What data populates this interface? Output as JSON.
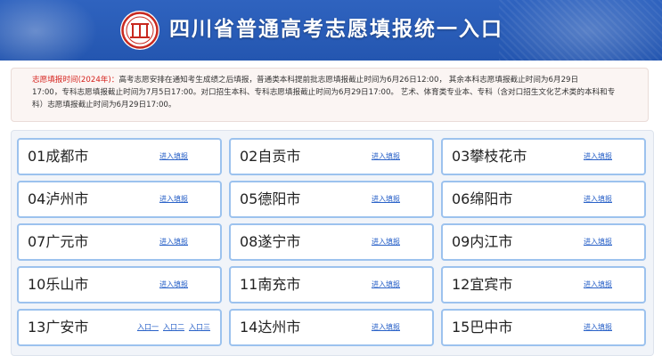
{
  "header": {
    "title": "四川省普通高考志愿填报统一入口",
    "logo_icon": "university-seal-icon",
    "bg_color": "#2a5cb6"
  },
  "notice": {
    "label": "志愿填报时间(2024年)：",
    "label_color": "#d6231e",
    "line1": "高考志愿安排在通知考生成绩之后填报，普通类本科提前批志愿填报截止时间为6月26日12:00， 其余本科志愿填报截止时间为6月29日",
    "line2": "17:00，专科志愿填报截止时间为7月5日17:00。对口招生本科、专科志愿填报截止时间为6月29日17:00。 艺术、体育类专业本、专科（含对口招生文化艺术类的本科和专",
    "line3": "科）志愿填报截止时间为6月29日17:00。"
  },
  "cities": [
    {
      "name": "01成都市",
      "links": [
        "进入填报"
      ]
    },
    {
      "name": "02自贡市",
      "links": [
        "进入填报"
      ]
    },
    {
      "name": "03攀枝花市",
      "links": [
        "进入填报"
      ]
    },
    {
      "name": "04泸州市",
      "links": [
        "进入填报"
      ]
    },
    {
      "name": "05德阳市",
      "links": [
        "进入填报"
      ]
    },
    {
      "name": "06绵阳市",
      "links": [
        "进入填报"
      ]
    },
    {
      "name": "07广元市",
      "links": [
        "进入填报"
      ]
    },
    {
      "name": "08遂宁市",
      "links": [
        "进入填报"
      ]
    },
    {
      "name": "09内江市",
      "links": [
        "进入填报"
      ]
    },
    {
      "name": "10乐山市",
      "links": [
        "进入填报"
      ]
    },
    {
      "name": "11南充市",
      "links": [
        "进入填报"
      ]
    },
    {
      "name": "12宜宾市",
      "links": [
        "进入填报"
      ]
    },
    {
      "name": "13广安市",
      "links": [
        "入口一",
        "入口二",
        "入口三"
      ]
    },
    {
      "name": "14达州市",
      "links": [
        "进入填报"
      ]
    },
    {
      "name": "15巴中市",
      "links": [
        "进入填报"
      ]
    }
  ],
  "colors": {
    "card_border": "#9cc2ee",
    "link": "#2a62c8",
    "grid_bg": "#f1f4f9"
  }
}
